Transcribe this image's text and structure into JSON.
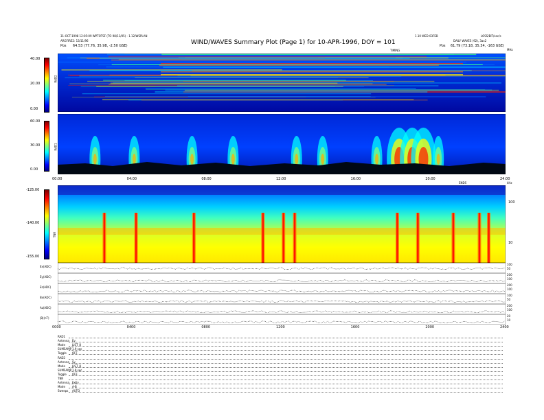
{
  "header": {
    "line1_left": "31-OCT-1998 12:05:09 WPTOTSF (TO 98/11/05) - 1.12/WSPLAN",
    "line2_left": "ARGFIRE2: 13/11/96",
    "line3_left_label": "Pos",
    "line3_left_value": "64.53 (77.76, 35.98, -2.50 GSE)",
    "line1_right": "1.10 WED 03FEB",
    "line1_far_right": "LOSS/BIT/sec/s",
    "line2_right": "DAILY WAVES (92), 3ax2",
    "line3_right_label": "Pos",
    "line3_right_value": "61.79 (73.18, 35.34, -163 GSE)",
    "title": "WIND/WAVES Summary Plot (Page 1) for 10-APR-1996, DOY = 101",
    "rad2_corner": "TIMING",
    "rad2_unit": "MHz",
    "tnr_corner": "ENDS",
    "tnr_unit": "kHz"
  },
  "rad2": {
    "ylabel": "RAD2",
    "ticks": [
      "40.00",
      "20.00",
      "0.00"
    ]
  },
  "rad1": {
    "ylabel": "RAD1",
    "ticks": [
      "60.00",
      "30.00",
      "0.00"
    ]
  },
  "tnr": {
    "ylabel": "TNR",
    "ticks": [
      "-125.00",
      "-140.00",
      "-155.00"
    ],
    "right_ticks": [
      "100",
      "10"
    ]
  },
  "time_axis": {
    "labels": [
      "00:00",
      "04:00",
      "08:00",
      "12:00",
      "16:00",
      "20:00",
      "24:00"
    ],
    "bottom_labels": [
      "0000",
      "0400",
      "0800",
      "1200",
      "1600",
      "2000",
      "2400"
    ]
  },
  "traces": [
    {
      "label": "Ex(ADC)",
      "right": [
        "100",
        "50"
      ]
    },
    {
      "label": "Ey(ADC)",
      "right": [
        "200",
        "100"
      ]
    },
    {
      "label": "Ez(ADC)",
      "right": [
        "200",
        "100"
      ]
    },
    {
      "label": "Bx(ADC)",
      "right": [
        "100",
        "50"
      ]
    },
    {
      "label": "Az(ADC)",
      "right": [
        "200",
        "100"
      ]
    },
    {
      "label": "|B|(nT)",
      "right": [
        "20",
        "10"
      ]
    }
  ],
  "settings": [
    {
      "label": "RAD1",
      "value": ""
    },
    {
      "label": "Antenna",
      "value": "Ey"
    },
    {
      "label": "Mode",
      "value": "LIST_8"
    },
    {
      "label": "SUMSAMP",
      "value": "1.9 sec"
    },
    {
      "label": "Toggle",
      "value": "OFF"
    },
    {
      "label": "RAD2",
      "value": ""
    },
    {
      "label": "Antenna",
      "value": "Sy"
    },
    {
      "label": "Mode",
      "value": "LIST_8"
    },
    {
      "label": "SUMSAMP",
      "value": "1.9 sec"
    },
    {
      "label": "Toggle",
      "value": "OFF"
    },
    {
      "label": "TNR",
      "value": ""
    },
    {
      "label": "Antenna",
      "value": "ExEy"
    },
    {
      "label": "Mode",
      "value": "A-B"
    },
    {
      "label": "Sweeps",
      "value": "AUTO"
    }
  ],
  "chart_data": {
    "type": "heatmap",
    "panels": [
      {
        "name": "RAD2",
        "unit": "MHz",
        "ylim": [
          0,
          40
        ]
      },
      {
        "name": "RAD1",
        "unit": "kHz",
        "ylim": [
          0,
          60
        ]
      },
      {
        "name": "TNR",
        "unit": "kHz",
        "ylim": [
          -155,
          -125
        ]
      }
    ],
    "x_range_hours": [
      0,
      24
    ],
    "rad1_bursts_hours": [
      2.0,
      4.1,
      7.2,
      9.4,
      12.8,
      14.2,
      17.1,
      18.3,
      19.0,
      19.6,
      20.4
    ],
    "tnr_spikes_hours": [
      2.5,
      4.2,
      7.3,
      11.0,
      12.1,
      12.7,
      18.2,
      19.3,
      21.2,
      22.6,
      23.1
    ],
    "colorscale": [
      "#00007f",
      "#0000ff",
      "#0080ff",
      "#00ffff",
      "#80ff80",
      "#ffff00",
      "#ff8000",
      "#ff0000",
      "#7f0000"
    ]
  }
}
